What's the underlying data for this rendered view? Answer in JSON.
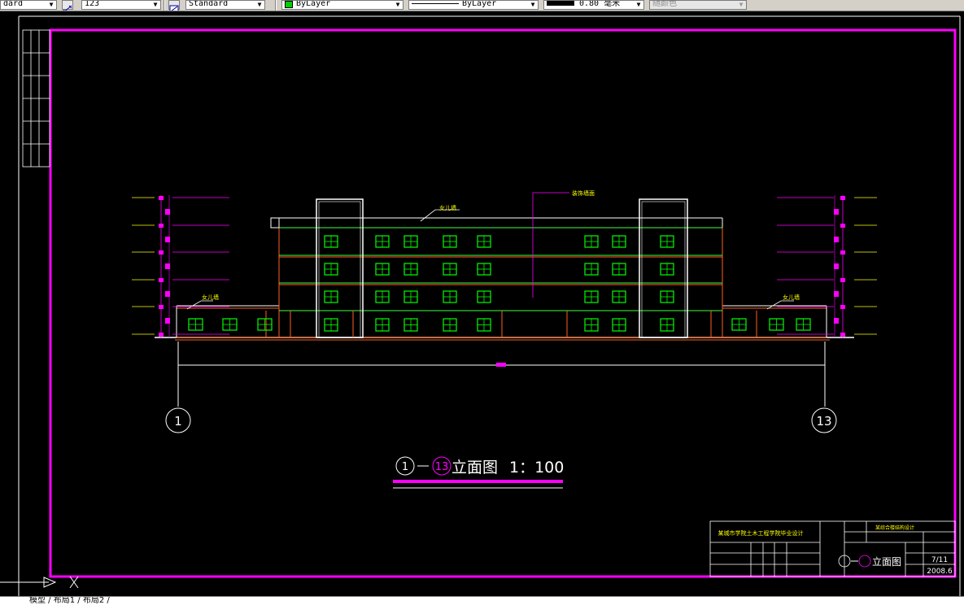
{
  "toolbar": {
    "text_style": "dard",
    "dim_value": "123",
    "dim_style": "Standard",
    "layer": "ByLayer",
    "linetype": "ByLayer",
    "lineweight": "0.80 毫米",
    "plot_style": "随颜色"
  },
  "drawing": {
    "title_main": "立面图",
    "title_scale": "1：100",
    "axis_start": "1",
    "axis_end": "13",
    "title_block": {
      "school": "某城市学院土木工程学院毕业设计",
      "project": "某综合楼结构设计",
      "drawing_name": "立面图",
      "sheet_no": "7/11",
      "date": "2008.6"
    }
  },
  "command_line": {
    "text": "模型 / 布局1 / 布局2 /"
  },
  "colors": {
    "frame": "#ff00ff",
    "wall": "#ff6020",
    "window": "#00ff00",
    "line": "#ffffff"
  }
}
